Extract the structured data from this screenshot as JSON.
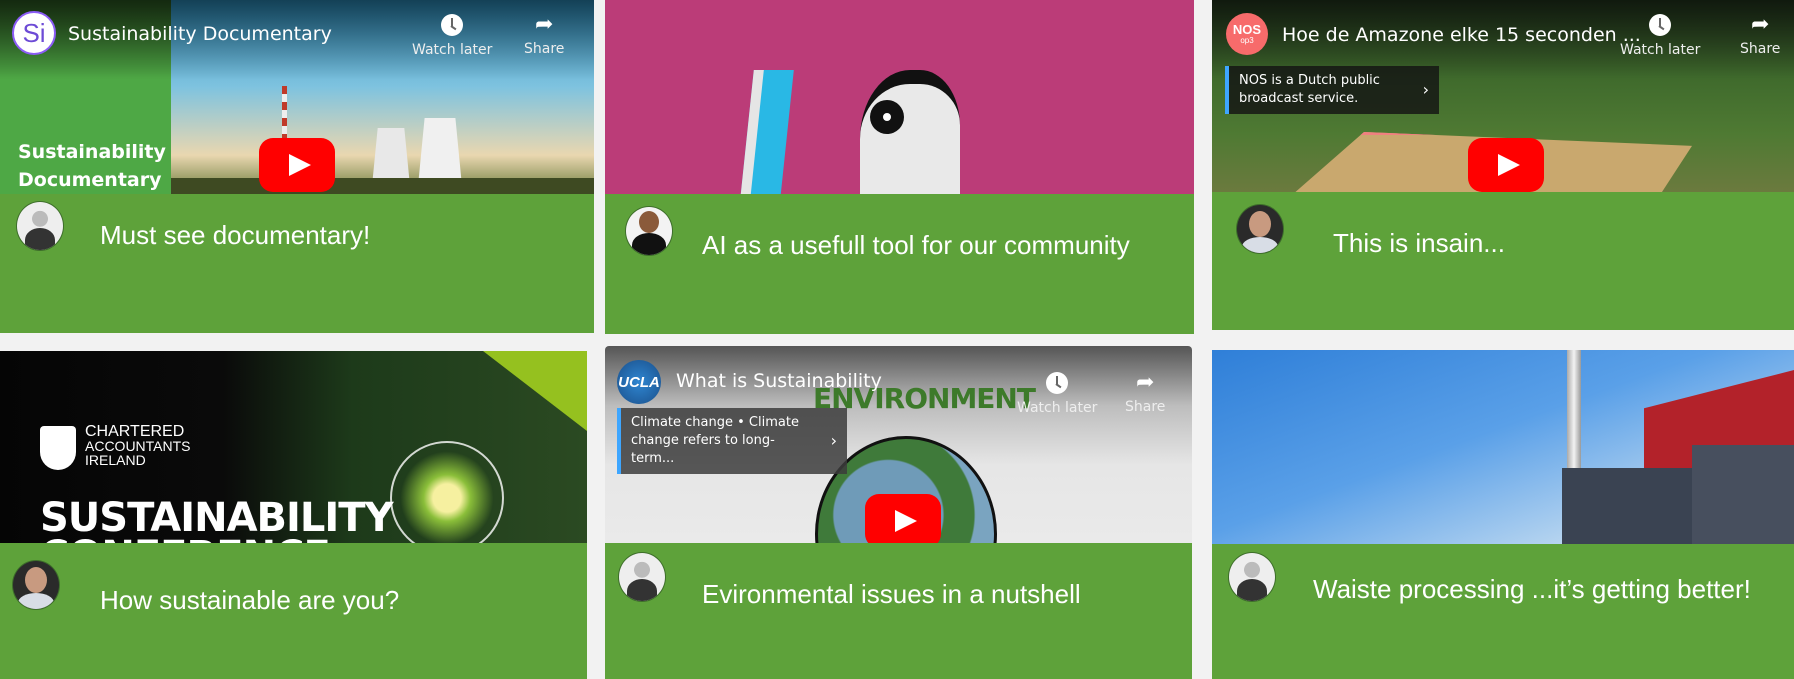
{
  "posts": [
    {
      "video": {
        "channel_badge": "Si",
        "title": "Sustainability Documentary",
        "overlay_text": "Sustainability Documentary",
        "watch_later": "Watch later",
        "share": "Share"
      },
      "caption": "Must see documentary!"
    },
    {
      "video": {},
      "caption": "AI as a usefull tool for our community"
    },
    {
      "video": {
        "channel_badge": "NOS",
        "channel_badge_sub": "op3",
        "title": "Hoe de Amazone elke 15 seconden ...",
        "info_card": "NOS is a Dutch public broadcast service.",
        "watch_later": "Watch later",
        "share": "Share"
      },
      "caption": "This is insain..."
    },
    {
      "video": {
        "brand_line1": "CHARTERED",
        "brand_line2": "ACCOUNTANTS",
        "brand_line3": "IRELAND",
        "headline1": "SUSTAINABILITY",
        "headline2": "CONFERENCE"
      },
      "caption": "How sustainable are you?"
    },
    {
      "video": {
        "channel_badge": "UCLA",
        "title": "What is Sustainability",
        "info_card": "Climate change • Climate change refers to long-term...",
        "watch_later": "Watch later",
        "share": "Share",
        "image_label": "ENVIRONMENT"
      },
      "caption": "Evironmental issues in a nutshell"
    },
    {
      "video": {},
      "caption": "Waiste processing ...it’s getting better!"
    }
  ],
  "colors": {
    "band_green": "#5ea23a",
    "page_bg": "#f2f2f2",
    "youtube_red": "#ff0000",
    "info_accent": "#3ea6ff"
  }
}
